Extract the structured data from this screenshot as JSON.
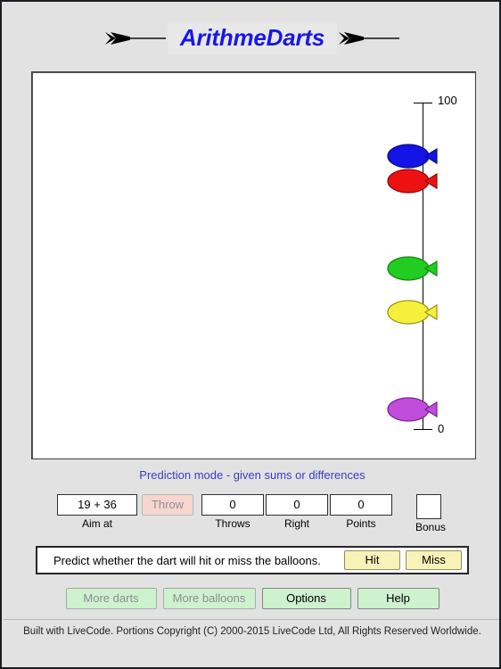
{
  "window": {
    "title": "ArithmeDarts",
    "background_color": "#e2e2e2",
    "title_color": "#1718e8"
  },
  "header": {
    "title": "ArithmeDarts",
    "left_dart_name": "dart-arrow-left",
    "right_dart_name": "dart-arrow-right"
  },
  "playfield": {
    "scale": {
      "top_label": "100",
      "bottom_label": "0",
      "axis_color": "#000000"
    },
    "balloons": [
      {
        "name": "balloon-blue",
        "color": "#1414e6",
        "outline": "#0b0b8c",
        "value": 86
      },
      {
        "name": "balloon-red",
        "color": "#ee1111",
        "outline": "#8c0b0b",
        "value": 79
      },
      {
        "name": "balloon-green",
        "color": "#22cc22",
        "outline": "#118811",
        "value": 53
      },
      {
        "name": "balloon-yellow",
        "color": "#f6f03c",
        "outline": "#9c9310",
        "value": 42
      },
      {
        "name": "balloon-purple",
        "color": "#c14ddb",
        "outline": "#7a1f99",
        "value": 18
      }
    ]
  },
  "mode_line": {
    "text": "Prediction mode - given sums or differences",
    "color": "#3b3bc4"
  },
  "stats": {
    "aim_at": {
      "label": "Aim at",
      "value": "19 + 36"
    },
    "throw": {
      "label": "Throw",
      "enabled": false
    },
    "throws": {
      "label": "Throws",
      "value": "0"
    },
    "right": {
      "label": "Right",
      "value": "0"
    },
    "points": {
      "label": "Points",
      "value": "0"
    },
    "bonus": {
      "label": "Bonus",
      "value": ""
    }
  },
  "prompt": {
    "text": "Predict whether the dart will hit or miss the balloons.",
    "hit_label": "Hit",
    "miss_label": "Miss",
    "button_color": "#f7f2b8"
  },
  "bottom_buttons": [
    {
      "label": "More darts",
      "enabled": false,
      "name": "more-darts-button"
    },
    {
      "label": "More balloons",
      "enabled": false,
      "name": "more-balloons-button"
    },
    {
      "label": "Options",
      "enabled": true,
      "name": "options-button"
    },
    {
      "label": "Help",
      "enabled": true,
      "name": "help-button"
    }
  ],
  "footer": {
    "text": "Built with LiveCode. Portions Copyright (C) 2000-2015 LiveCode Ltd, All Rights Reserved Worldwide."
  }
}
